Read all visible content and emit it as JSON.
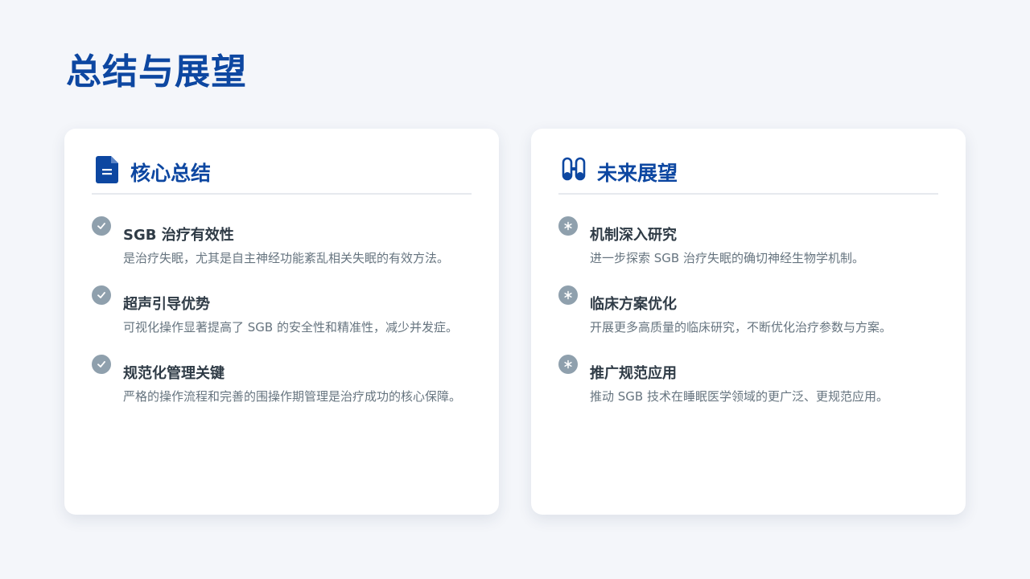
{
  "slide": {
    "title": "总结与展望"
  },
  "summary_card": {
    "title": "核心总结",
    "icon": "document-icon",
    "items": [
      {
        "title": "SGB 治疗有效性",
        "desc": "是治疗失眠，尤其是自主神经功能紊乱相关失眠的有效方法。"
      },
      {
        "title": "超声引导优势",
        "desc": "可视化操作显著提高了 SGB 的安全性和精准性，减少并发症。"
      },
      {
        "title": "规范化管理关键",
        "desc": "严格的操作流程和完善的围操作期管理是治疗成功的核心保障。"
      }
    ]
  },
  "outlook_card": {
    "title": "未来展望",
    "icon": "binoculars-icon",
    "items": [
      {
        "title": "机制深入研究",
        "desc": "进一步探索 SGB 治疗失眠的确切神经生物学机制。"
      },
      {
        "title": "临床方案优化",
        "desc": "开展更多高质量的临床研究，不断优化治疗参数与方案。"
      },
      {
        "title": "推广规范应用",
        "desc": "推动 SGB 技术在睡眠医学领域的更广泛、更规范应用。"
      }
    ]
  },
  "colors": {
    "accent": "#0d47a1",
    "badge": "#8fa0ad",
    "background": "#f4f6fa"
  }
}
